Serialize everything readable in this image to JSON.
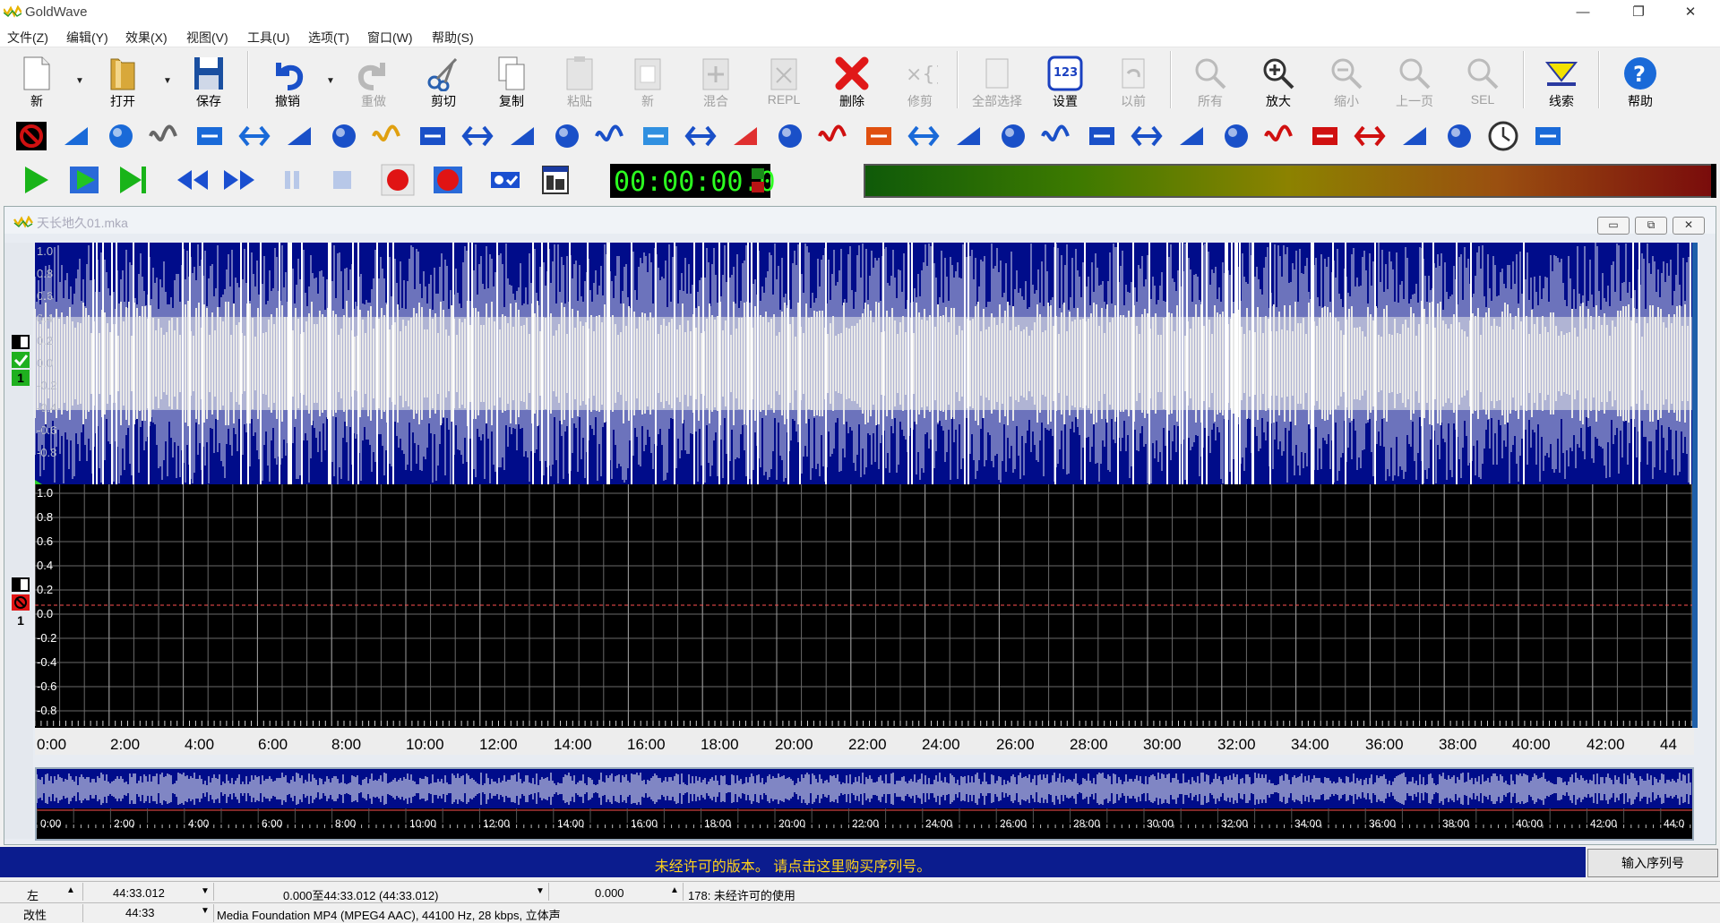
{
  "window": {
    "title": "GoldWave",
    "minimize_glyph": "—",
    "restore_glyph": "❐",
    "close_glyph": "✕"
  },
  "menu": [
    "文件(Z)",
    "编辑(Y)",
    "效果(X)",
    "视图(V)",
    "工具(U)",
    "选项(T)",
    "窗口(W)",
    "帮助(S)"
  ],
  "toolbar": {
    "new": "新",
    "open": "打开",
    "save": "保存",
    "undo": "撤销",
    "redo": "重做",
    "cut": "剪切",
    "copy": "复制",
    "paste": "粘贴",
    "paste_new": "新",
    "mix": "混合",
    "replace": "REPL",
    "delete": "删除",
    "trim": "修剪",
    "select_all": "全部选择",
    "set": "设置",
    "previous": "以前",
    "all": "所有",
    "zoom_in": "放大",
    "zoom_out": "缩小",
    "prev_page": "上一页",
    "sel": "SEL",
    "cue": "线索",
    "help": "帮助"
  },
  "transport": {
    "time": "00:00:00.0"
  },
  "document": {
    "title": "天长地久01.mka",
    "min_glyph": "▭",
    "max_glyph": "⧉",
    "close_glyph": "✕",
    "channel1_labels": [
      "1.0",
      "0.8",
      "0.6",
      "0.4",
      "0.2",
      "0.0",
      "-0.2",
      "-0.4",
      "-0.6",
      "-0.8"
    ],
    "channel2_labels": [
      "1.0",
      "0.8",
      "0.6",
      "0.4",
      "0.2",
      "0.0",
      "-0.2",
      "-0.4",
      "-0.6",
      "-0.8"
    ],
    "channel_number": "1",
    "timeline": [
      "0:00",
      "2:00",
      "4:00",
      "6:00",
      "8:00",
      "10:00",
      "12:00",
      "14:00",
      "16:00",
      "18:00",
      "20:00",
      "22:00",
      "24:00",
      "26:00",
      "28:00",
      "30:00",
      "32:00",
      "34:00",
      "36:00",
      "38:00",
      "40:00",
      "42:00",
      "44"
    ],
    "overview_timeline": [
      "0:00",
      "2:00",
      "4:00",
      "6:00",
      "8:00",
      "10:00",
      "12:00",
      "14:00",
      "16:00",
      "18:00",
      "20:00",
      "22:00",
      "24:00",
      "26:00",
      "28:00",
      "30:00",
      "32:00",
      "34:00",
      "36:00",
      "38:00",
      "40:00",
      "42:00",
      "44:0"
    ]
  },
  "banner": {
    "message": "未经许可的版本。 请点击这里购买序列号。",
    "serial_button": "输入序列号"
  },
  "status": {
    "channel": "左",
    "length": "44:33.012",
    "selection": "0.000至44:33.012 (44:33.012)",
    "position": "0.000",
    "info": "178: 未经许可的使用",
    "modified": "改性",
    "duration": "44:33",
    "format": "Media Foundation MP4 (MPEG4 AAC), 44100 Hz, 28 kbps, 立体声"
  },
  "colors": {
    "waveform_bg": "#000c8a",
    "waveform_fg": "#ffffff",
    "time_display": "#2cff20",
    "banner_bg": "#0b1c8e",
    "banner_text": "#ffd21a"
  }
}
